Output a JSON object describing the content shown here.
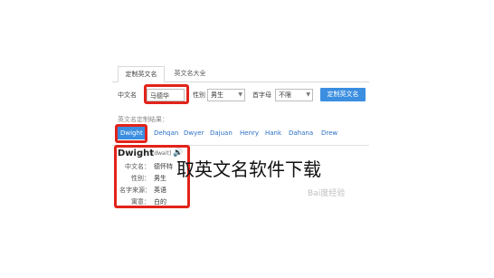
{
  "tabs": [
    {
      "label": "定制英文名"
    },
    {
      "label": "英文名大全"
    }
  ],
  "form": {
    "chinese_name_label": "中文名",
    "chinese_name_value": "马德华",
    "gender_label": "性别",
    "gender_value": "男生",
    "initial_label": "首字母",
    "initial_value": "不限",
    "submit_label": "定制英文名"
  },
  "results": {
    "heading": "英文名定制结果：",
    "names": [
      "Dwight",
      "Dehqan",
      "Dwyer",
      "Dajuan",
      "Henry",
      "Hank",
      "Dahana",
      "Drew"
    ],
    "selected_index": 0
  },
  "detail": {
    "name": "Dwight",
    "phonetic": "[dwait]",
    "rows": [
      {
        "key": "中文名：",
        "value": "德怀特"
      },
      {
        "key": "性别：",
        "value": "男生"
      },
      {
        "key": "名字来源：",
        "value": "英语"
      },
      {
        "key": "寓意：",
        "value": "白的"
      }
    ]
  },
  "overlay_caption": "取英文名软件下载",
  "watermark": "Bai度经验",
  "colors": {
    "accent": "#3b8ee0",
    "highlight_box": "#e2231a"
  }
}
